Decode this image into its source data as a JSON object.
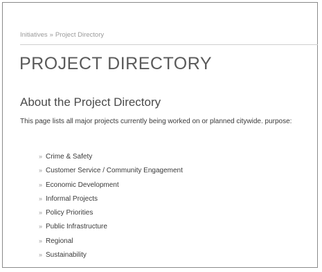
{
  "breadcrumb": {
    "parent": "Initiatives",
    "separator": "»",
    "current": "Project Directory"
  },
  "page_title": "PROJECT DIRECTORY",
  "section_heading": "About the Project Directory",
  "intro_text": "This page lists all major projects currently being worked on or planned citywide. purpose:",
  "bullet_glyph": "»",
  "categories": [
    "Crime & Safety",
    "Customer Service / Community Engagement",
    "Economic Development",
    "Informal Projects",
    "Policy Priorities",
    "Public Infrastructure",
    "Regional",
    "Sustainability"
  ],
  "colors": {
    "title": "#5a5a5a",
    "text": "#3a3a3a",
    "muted": "#9a9a9a",
    "rule": "#cfcfcf"
  }
}
